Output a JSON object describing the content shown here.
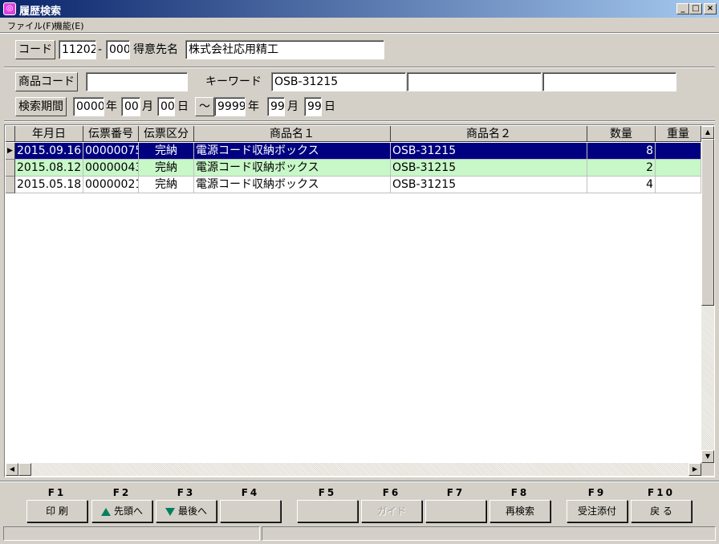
{
  "window": {
    "icon": "app-icon",
    "title": "履歴検索",
    "controls": [
      "minimize-icon",
      "maximize-icon",
      "close-icon"
    ]
  },
  "menu": [
    {
      "label": "ファイル(F)"
    },
    {
      "label": "機能(E)"
    }
  ],
  "customer": {
    "code_label": "コード",
    "code_value": "11202",
    "code_dash": "-",
    "code_branch": "000",
    "name_label": "得意先名",
    "name_value": "株式会社応用精工"
  },
  "search": {
    "product_code_label": "商品コード",
    "product_code_value": "",
    "keyword_label": "キーワード",
    "keyword_1": "OSB-31215",
    "keyword_2": "",
    "keyword_3": "",
    "period_label": "検索期間",
    "from_year": "0000",
    "from_month": "00",
    "from_day": "00",
    "to_button": "～",
    "to_year": "9999",
    "to_month": "99",
    "to_day": "99",
    "year_unit": "年",
    "month_unit": "月",
    "day_unit": "日"
  },
  "grid": {
    "columns": [
      "年月日",
      "伝票番号",
      "伝票区分",
      "商品名１",
      "商品名２",
      "数量",
      "重量"
    ],
    "rows": [
      [
        "2015.09.16",
        "00000075",
        "完納",
        "電源コード収納ボックス",
        "OSB-31215",
        "8",
        ""
      ],
      [
        "2015.08.12",
        "00000043",
        "完納",
        "電源コード収納ボックス",
        "OSB-31215",
        "2",
        ""
      ],
      [
        "2015.05.18",
        "00000021",
        "完納",
        "電源コード収納ボックス",
        "OSB-31215",
        "4",
        ""
      ]
    ],
    "selected_row": 0,
    "row_marker": "▶"
  },
  "function_keys": [
    {
      "key": "F1",
      "label": "印 刷",
      "enabled": true
    },
    {
      "key": "F2",
      "label": "先頭へ",
      "icon": "arrow-up-icon",
      "enabled": true
    },
    {
      "key": "F3",
      "label": "最後へ",
      "icon": "arrow-down-icon",
      "enabled": true
    },
    {
      "key": "F4",
      "label": "",
      "enabled": true
    },
    {
      "key": "F5",
      "label": "",
      "enabled": true
    },
    {
      "key": "F6",
      "label": "ガイド",
      "enabled": false
    },
    {
      "key": "F7",
      "label": "",
      "enabled": true
    },
    {
      "key": "F8",
      "label": "再検索",
      "enabled": true
    },
    {
      "key": "F9",
      "label": "受注添付",
      "enabled": true
    },
    {
      "key": "F10",
      "label": "戻 る",
      "enabled": true
    }
  ],
  "colors": {
    "selected_row": "#000080",
    "alt_row": "#c8f7c8",
    "titlebar": "#0a246a"
  }
}
